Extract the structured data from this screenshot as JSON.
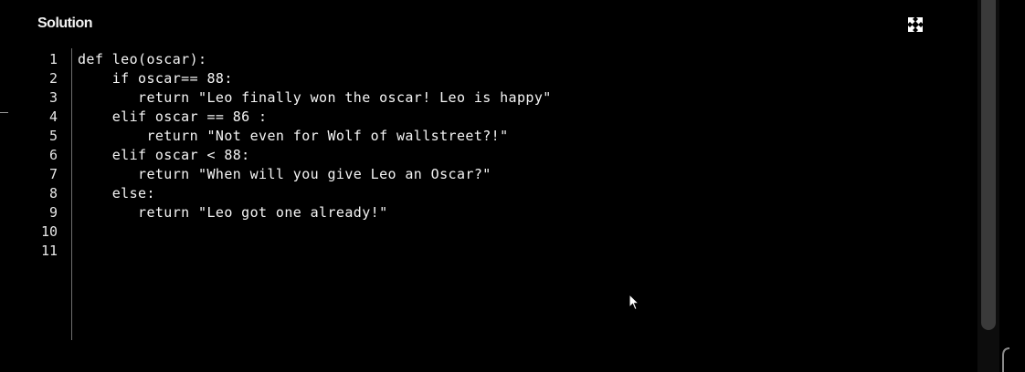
{
  "panel": {
    "title": "Solution",
    "fullscreen_icon": "expand-arrows-icon"
  },
  "editor": {
    "language": "python",
    "line_numbers": [
      "1",
      "2",
      "3",
      "4",
      "5",
      "6",
      "7",
      "8",
      "9",
      "10",
      "11"
    ],
    "lines": [
      "def leo(oscar):",
      "    if oscar== 88:",
      "       return \"Leo finally won the oscar! Leo is happy\"",
      "    elif oscar == 86 :",
      "        return \"Not even for Wolf of wallstreet?!\"",
      "    elif oscar < 88:",
      "       return \"When will you give Leo an Oscar?\"",
      "    else:",
      "       return \"Leo got one already!\"",
      "",
      ""
    ]
  },
  "colors": {
    "background": "#000000",
    "text": "#f5f5f5",
    "gutter_border": "#6e6e6e",
    "scrollbar_thumb": "#3a3a3a"
  },
  "icons": {
    "cursor": "mouse-pointer-icon"
  }
}
